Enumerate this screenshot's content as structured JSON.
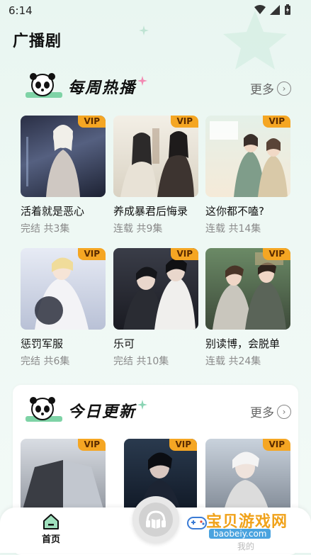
{
  "status": {
    "time": "6:14"
  },
  "page": {
    "title": "广播剧"
  },
  "weekly": {
    "title": "每周热播",
    "more": "更多",
    "items": [
      {
        "title": "活着就是恶心",
        "sub": "完结 共3集",
        "badge": "VIP"
      },
      {
        "title": "养成暴君后悔录",
        "sub": "连载 共9集",
        "badge": "VIP"
      },
      {
        "title": "这你都不嗑?",
        "sub": "连载 共14集",
        "badge": "VIP"
      },
      {
        "title": "惩罚军服",
        "sub": "完结 共6集",
        "badge": "VIP"
      },
      {
        "title": "乐可",
        "sub": "完结 共10集",
        "badge": "VIP"
      },
      {
        "title": "别读博，会脱单",
        "sub": "连载 共24集",
        "badge": "VIP"
      }
    ]
  },
  "today": {
    "title": "今日更新",
    "more": "更多",
    "items": [
      {
        "badge": "VIP"
      },
      {
        "badge": "VIP"
      },
      {
        "badge": "VIP"
      }
    ]
  },
  "nav": {
    "home_label": "首页",
    "home_icon": "home-icon",
    "player_icon": "headphones-book-icon"
  },
  "watermark": {
    "name": "宝贝游戏网",
    "url": "baobeiy.com",
    "mine": "我的"
  },
  "colors": {
    "vip_badge": "#f5a623",
    "accent_green": "#2f8f5b"
  }
}
